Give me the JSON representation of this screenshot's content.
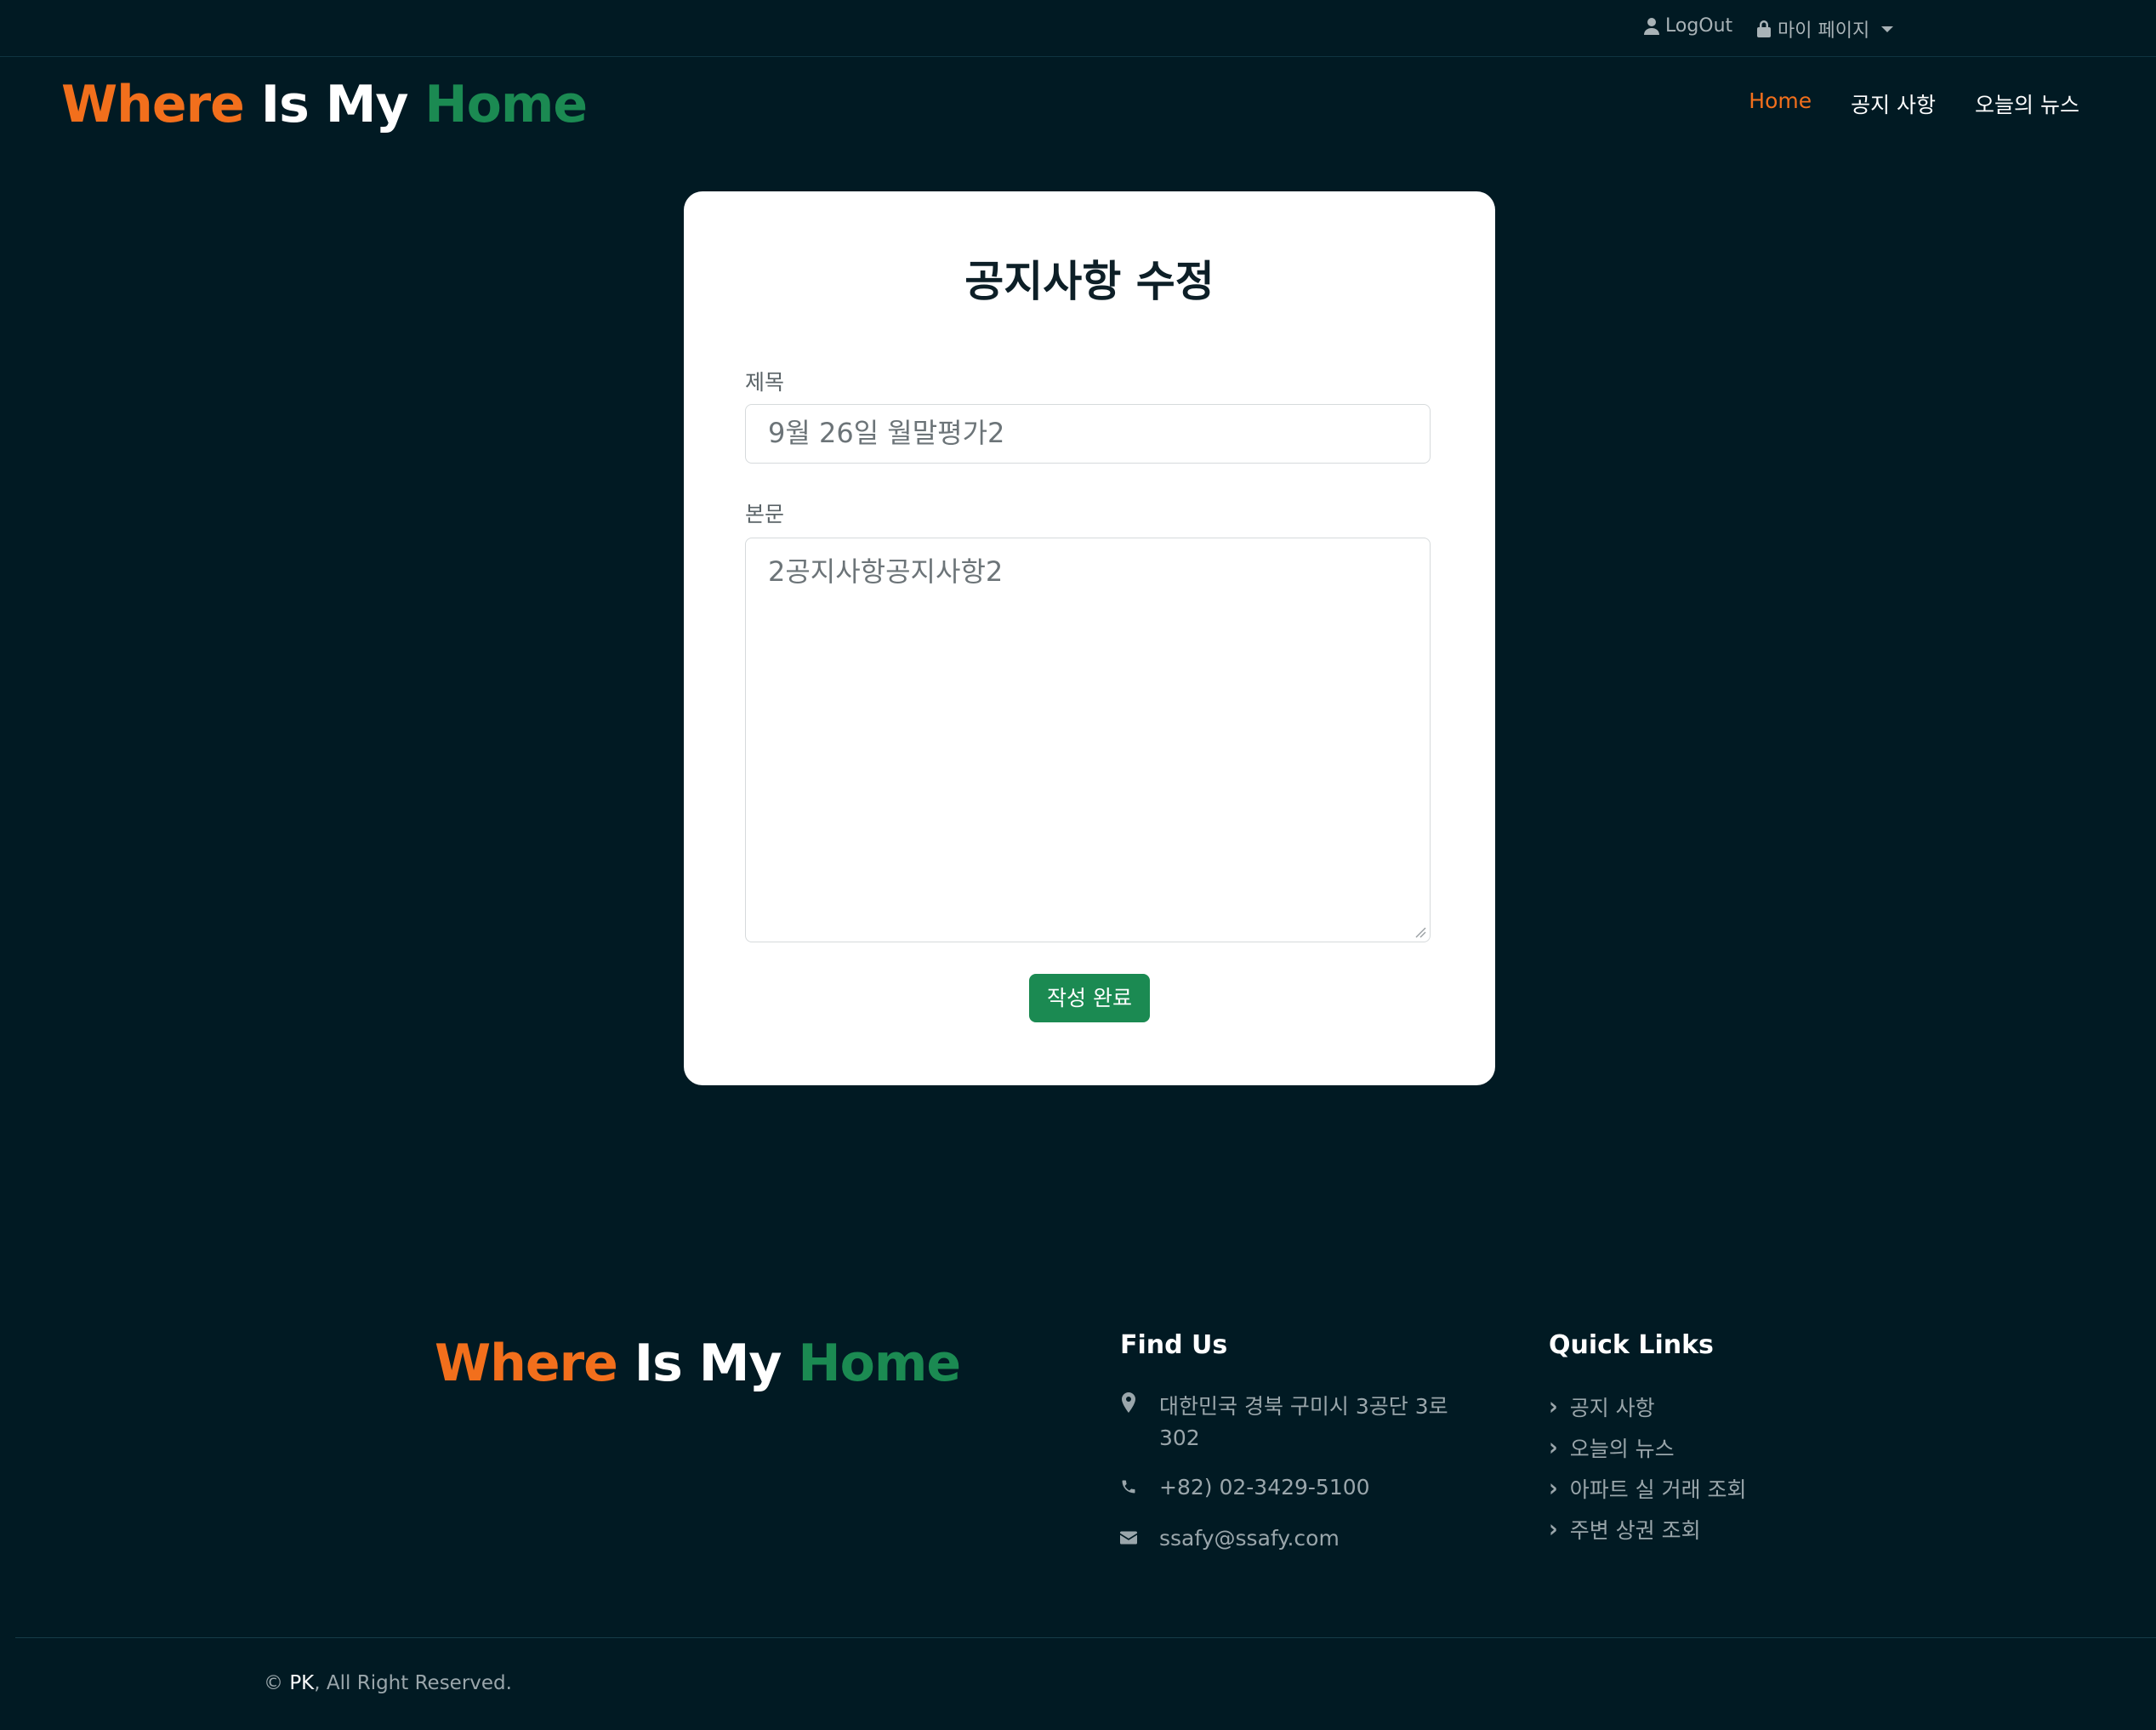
{
  "topbar": {
    "logout_label": "LogOut",
    "mypage_label": "마이 페이지"
  },
  "header": {
    "logo": {
      "part1": "Where",
      "part2": "Is My",
      "part3": "Home"
    },
    "nav": [
      {
        "label": "Home",
        "active": true
      },
      {
        "label": "공지 사항",
        "active": false
      },
      {
        "label": "오늘의 뉴스",
        "active": false
      }
    ]
  },
  "form": {
    "title": "공지사항 수정",
    "title_field_label": "제목",
    "title_value": "9월 26일 월말평가2",
    "body_field_label": "본문",
    "body_value": "2공지사항공지사항2",
    "submit_label": "작성 완료"
  },
  "footer": {
    "logo": {
      "part1": "Where",
      "part2": "Is My",
      "part3": "Home"
    },
    "find_us": {
      "heading": "Find Us",
      "address": "대한민국 경북 구미시 3공단 3로 302",
      "phone": "+82) 02-3429-5100",
      "email": "ssafy@ssafy.com"
    },
    "quick_links": {
      "heading": "Quick Links",
      "items": [
        "공지 사항",
        "오늘의 뉴스",
        "아파트 실 거래 조회",
        "주변 상권 조회"
      ]
    },
    "copyright": {
      "owner": "PK",
      "text": ", All Right Reserved.",
      "symbol": "©"
    }
  },
  "colors": {
    "background": "#011a23",
    "accent_orange": "#f26f1c",
    "accent_green": "#1b8a52"
  }
}
